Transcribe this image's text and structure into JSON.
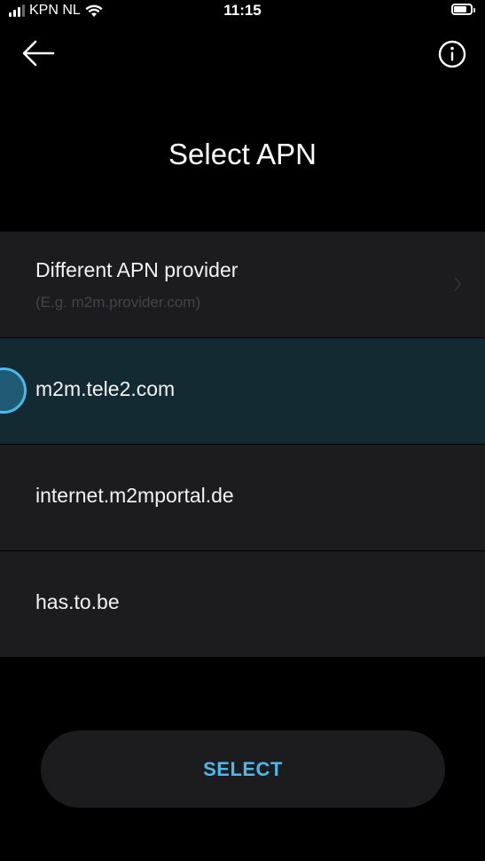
{
  "status_bar": {
    "carrier": "KPN NL",
    "time": "11:15"
  },
  "header": {
    "back_icon": "arrow-left-icon",
    "info_icon": "info-circle-icon",
    "title": "Select APN"
  },
  "apn_list": {
    "custom": {
      "label": "Different APN provider",
      "placeholder": "(E.g. m2m.provider.com)"
    },
    "items": [
      {
        "label": "m2m.tele2.com",
        "selected": true
      },
      {
        "label": "internet.m2mportal.de",
        "selected": false
      },
      {
        "label": "has.to.be",
        "selected": false
      }
    ]
  },
  "footer": {
    "select_label": "SELECT"
  },
  "colors": {
    "background": "#000000",
    "row": "#1c1c1e",
    "row_selected": "#132a33",
    "accent": "#4fb7e6"
  }
}
